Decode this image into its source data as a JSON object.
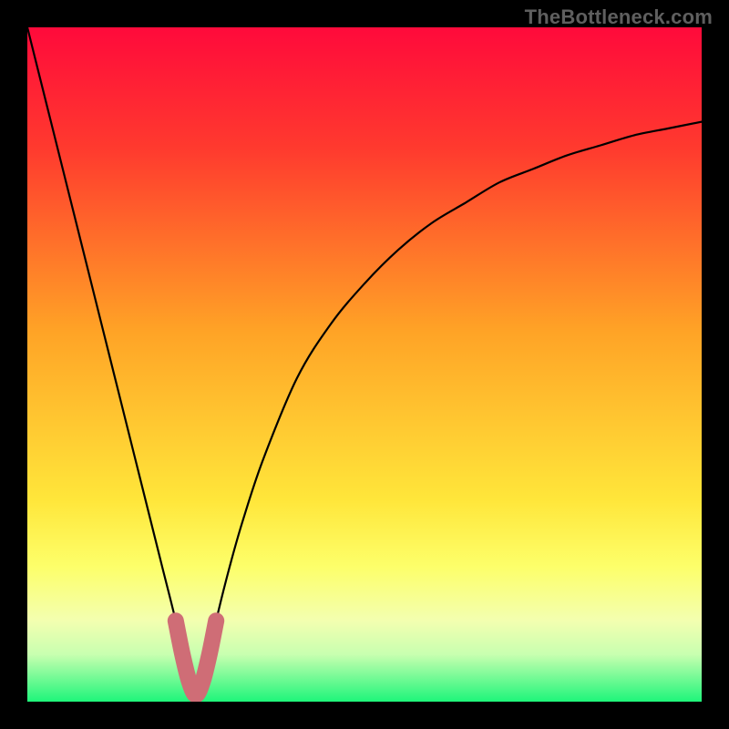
{
  "watermark": "TheBottleneck.com",
  "chart_data": {
    "type": "line",
    "title": "",
    "xlabel": "",
    "ylabel": "",
    "xlim": [
      0,
      100
    ],
    "ylim": [
      0,
      100
    ],
    "curve": {
      "name": "bottleneck-curve",
      "x": [
        0,
        2,
        4,
        6,
        8,
        10,
        12,
        14,
        16,
        18,
        20,
        22,
        23,
        24,
        25,
        26,
        27,
        28,
        30,
        32,
        35,
        40,
        45,
        50,
        55,
        60,
        65,
        70,
        75,
        80,
        85,
        90,
        95,
        100
      ],
      "y": [
        100,
        92,
        84,
        76,
        68,
        60,
        52,
        44,
        36,
        28,
        20,
        12,
        7,
        3,
        1,
        3,
        7,
        12,
        20,
        27,
        36,
        48,
        56,
        62,
        67,
        71,
        74,
        77,
        79,
        81,
        82.5,
        84,
        85,
        86
      ]
    },
    "highlight": {
      "name": "min-region",
      "x": [
        22,
        23,
        24,
        25,
        26,
        27,
        28
      ],
      "y": [
        12,
        7,
        3,
        1,
        3,
        7,
        12
      ],
      "color": "#cf6d76"
    },
    "gradient_stops": [
      {
        "pct": 0,
        "color": "#ff0a3b"
      },
      {
        "pct": 18,
        "color": "#ff3a2e"
      },
      {
        "pct": 45,
        "color": "#ffa326"
      },
      {
        "pct": 70,
        "color": "#ffe63a"
      },
      {
        "pct": 80,
        "color": "#fdff6a"
      },
      {
        "pct": 88,
        "color": "#f3ffb0"
      },
      {
        "pct": 93,
        "color": "#c8ffb0"
      },
      {
        "pct": 100,
        "color": "#1ef57a"
      }
    ]
  }
}
